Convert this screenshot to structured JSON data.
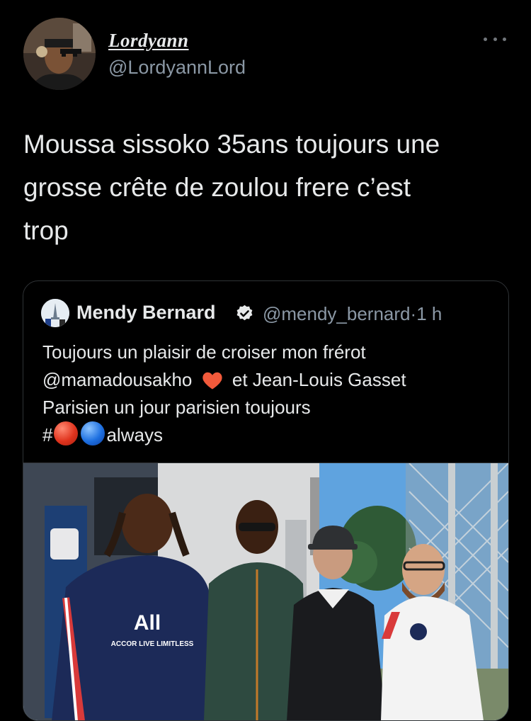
{
  "tweet": {
    "author": {
      "display_name": "Lordyann",
      "handle": "@LordyannLord"
    },
    "text_lines": [
      "Moussa sissoko 35ans toujours une",
      "grosse crête de zoulou frere c’est",
      "trop"
    ],
    "more_icon": "more-horizontal-icon"
  },
  "quote": {
    "author": {
      "display_name": "Mendy Bernard",
      "handle": "@mendy_bernard",
      "separator": "·",
      "time": "1 h",
      "verified_icon": "verified-badge-icon"
    },
    "text": {
      "line1": "Toujours un plaisir de croiser mon frérot",
      "mention": "@mamadousakho",
      "line2_rest": "et Jean-Louis Gasset",
      "line3": "Parisien un jour parisien toujours",
      "hashtag_prefix": "#",
      "hashtag_suffix": "always"
    },
    "emojis": [
      "heart-icon",
      "red-circle",
      "blue-circle"
    ],
    "photo": {
      "jersey_text": "All",
      "jersey_sub": "ACCOR LIVE LIMITLESS"
    }
  },
  "colors": {
    "background": "#000000",
    "text": "#e7e9ea",
    "secondary_text": "#8b98a5",
    "border": "#2f3336",
    "heart": "#f25a3b"
  }
}
